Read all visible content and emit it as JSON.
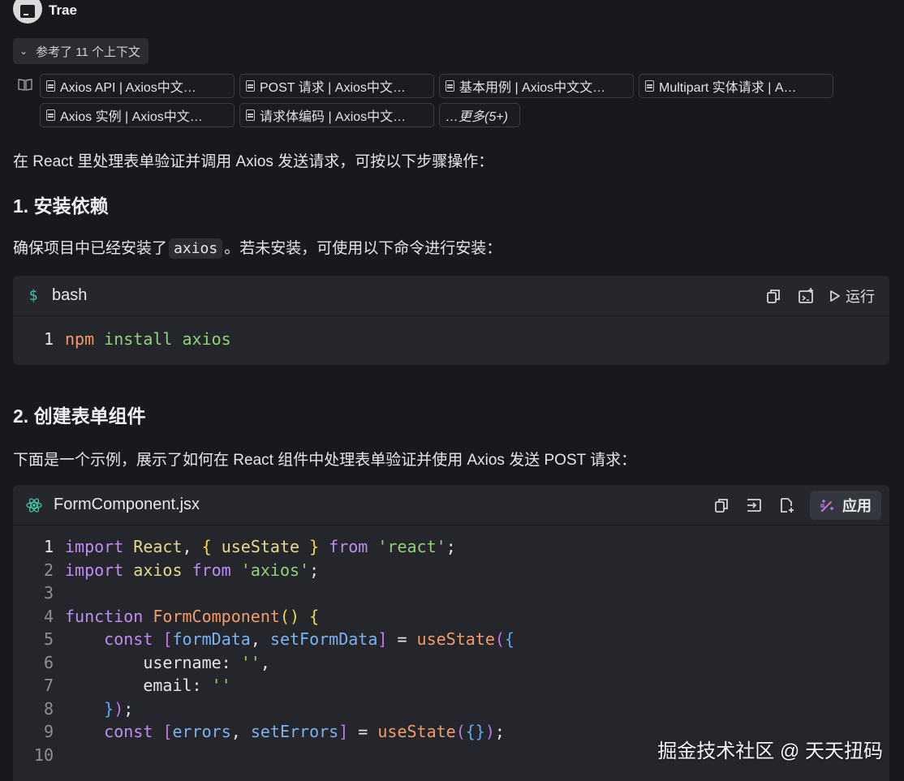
{
  "header": {
    "assistant_name": "Trae"
  },
  "references": {
    "toggle_label": "参考了 11 个上下文",
    "chips": [
      "Axios API | Axios中文…",
      "POST 请求 | Axios中文…",
      "基本用例 | Axios中文文…",
      "Multipart 实体请求 | A…",
      "Axios 实例 | Axios中文…",
      "请求体编码 | Axios中文…"
    ],
    "more_label": "…更多(5+)"
  },
  "content": {
    "intro": "在 React 里处理表单验证并调用 Axios 发送请求，可按以下步骤操作：",
    "section1_title": "1. 安装依赖",
    "section1_text_before": "确保项目中已经安装了",
    "section1_code": "axios",
    "section1_text_after": "。若未安装，可使用以下命令进行安装：",
    "section2_title": "2. 创建表单组件",
    "section2_text": "下面是一个示例，展示了如何在 React 组件中处理表单验证并使用 Axios 发送 POST 请求："
  },
  "bash_block": {
    "lang_icon": "$",
    "lang_label": "bash",
    "run_label": "运行",
    "line_number": "1",
    "cmd": "npm",
    "args": " install axios"
  },
  "jsx_block": {
    "file_label": "FormComponent.jsx",
    "apply_label": "应用",
    "line_numbers": [
      "1",
      "2",
      "3",
      "4",
      "5",
      "6",
      "7",
      "8",
      "9",
      "10"
    ]
  },
  "watermark": "掘金技术社区 @ 天天扭码",
  "colors": {
    "background": "#18191d",
    "code_bg": "#24262c",
    "keyword": "#c18cf0",
    "string": "#93d07a"
  }
}
